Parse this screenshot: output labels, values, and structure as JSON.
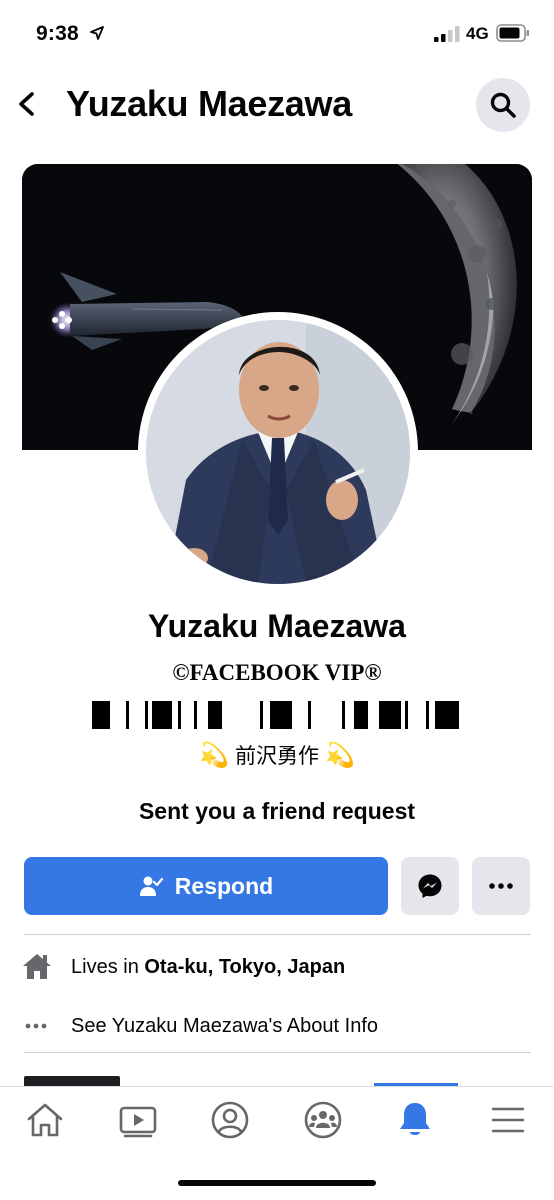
{
  "status_bar": {
    "time": "9:38",
    "network": "4G",
    "icons": [
      "location-arrow-icon",
      "signal-icon",
      "battery-icon"
    ]
  },
  "header": {
    "title": "Yuzaku Maezawa",
    "back_icon": "chevron-left-icon",
    "search_icon": "search-icon"
  },
  "profile": {
    "name": "Yuzaku Maezawa",
    "vip_line": "©FACEBOOK VIP®",
    "bio_emoji": "💫",
    "bio_text": "前沢勇作",
    "request_text": "Sent you a friend request"
  },
  "actions": {
    "respond_label": "Respond",
    "respond_icon": "person-check-icon",
    "messenger_icon": "messenger-icon",
    "more_icon": "more-dots-icon"
  },
  "info": {
    "lives_prefix": "Lives in ",
    "lives_location": "Ota-ku, Tokyo, Japan",
    "about_label": "See Yuzaku Maezawa's About Info"
  },
  "bottom_nav": {
    "items": [
      "home-icon",
      "watch-icon",
      "profile-icon",
      "groups-icon",
      "notifications-icon",
      "menu-icon"
    ],
    "active": "notifications-icon"
  },
  "colors": {
    "accent": "#3578e5",
    "button_grey": "#e4e6eb",
    "text": "#050505",
    "divider": "#ced0d4"
  }
}
